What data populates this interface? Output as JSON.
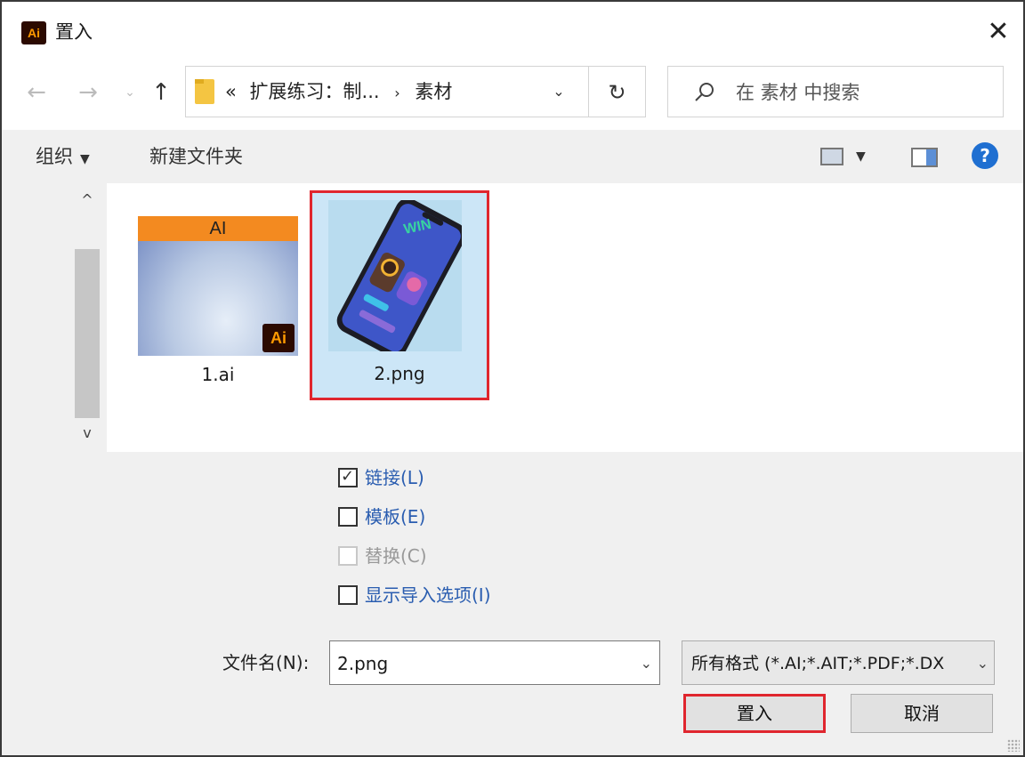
{
  "window": {
    "title": "置入",
    "app_icon_label": "Ai",
    "close_glyph": "✕"
  },
  "nav": {
    "back_glyph": "←",
    "forward_glyph": "→",
    "recent_glyph": "⌄",
    "up_glyph": "↑",
    "refresh_glyph": "↻",
    "breadcrumb": {
      "overflow": "«",
      "parent": "扩展练习：制...",
      "separator": "›",
      "current": "素材"
    },
    "dropdown_glyph": "⌄"
  },
  "search": {
    "placeholder": "在 素材 中搜索"
  },
  "toolbar": {
    "organize_label": "组织",
    "organize_caret": "▼",
    "new_folder_label": "新建文件夹",
    "view_caret": "▼",
    "help_glyph": "?"
  },
  "scrollbar": {
    "up_glyph": "^",
    "down_glyph": "v"
  },
  "files": [
    {
      "name": "1.ai",
      "thumb_header": "AI",
      "thumb_badge": "Ai",
      "selected": false
    },
    {
      "name": "2.png",
      "thumb_text": "WIN",
      "selected": true
    }
  ],
  "options": {
    "link": {
      "label": "链接(L)",
      "checked": true
    },
    "template": {
      "label": "模板(E)",
      "checked": false
    },
    "replace": {
      "label": "替换(C)",
      "checked": false,
      "disabled": true
    },
    "show_import": {
      "label": "显示导入选项(I)",
      "checked": false
    }
  },
  "filename": {
    "label": "文件名(N):",
    "value": "2.png",
    "caret": "⌄"
  },
  "filetype": {
    "value": "所有格式 (*.AI;*.AIT;*.PDF;*.DX",
    "caret": "⌄"
  },
  "buttons": {
    "place": "置入",
    "cancel": "取消"
  },
  "colors": {
    "highlight_red": "#e0262e",
    "selection_blue": "#cce6f7",
    "link_blue": "#2a5db0",
    "ai_orange": "#f38a20",
    "ai_dark": "#2b0a00"
  }
}
